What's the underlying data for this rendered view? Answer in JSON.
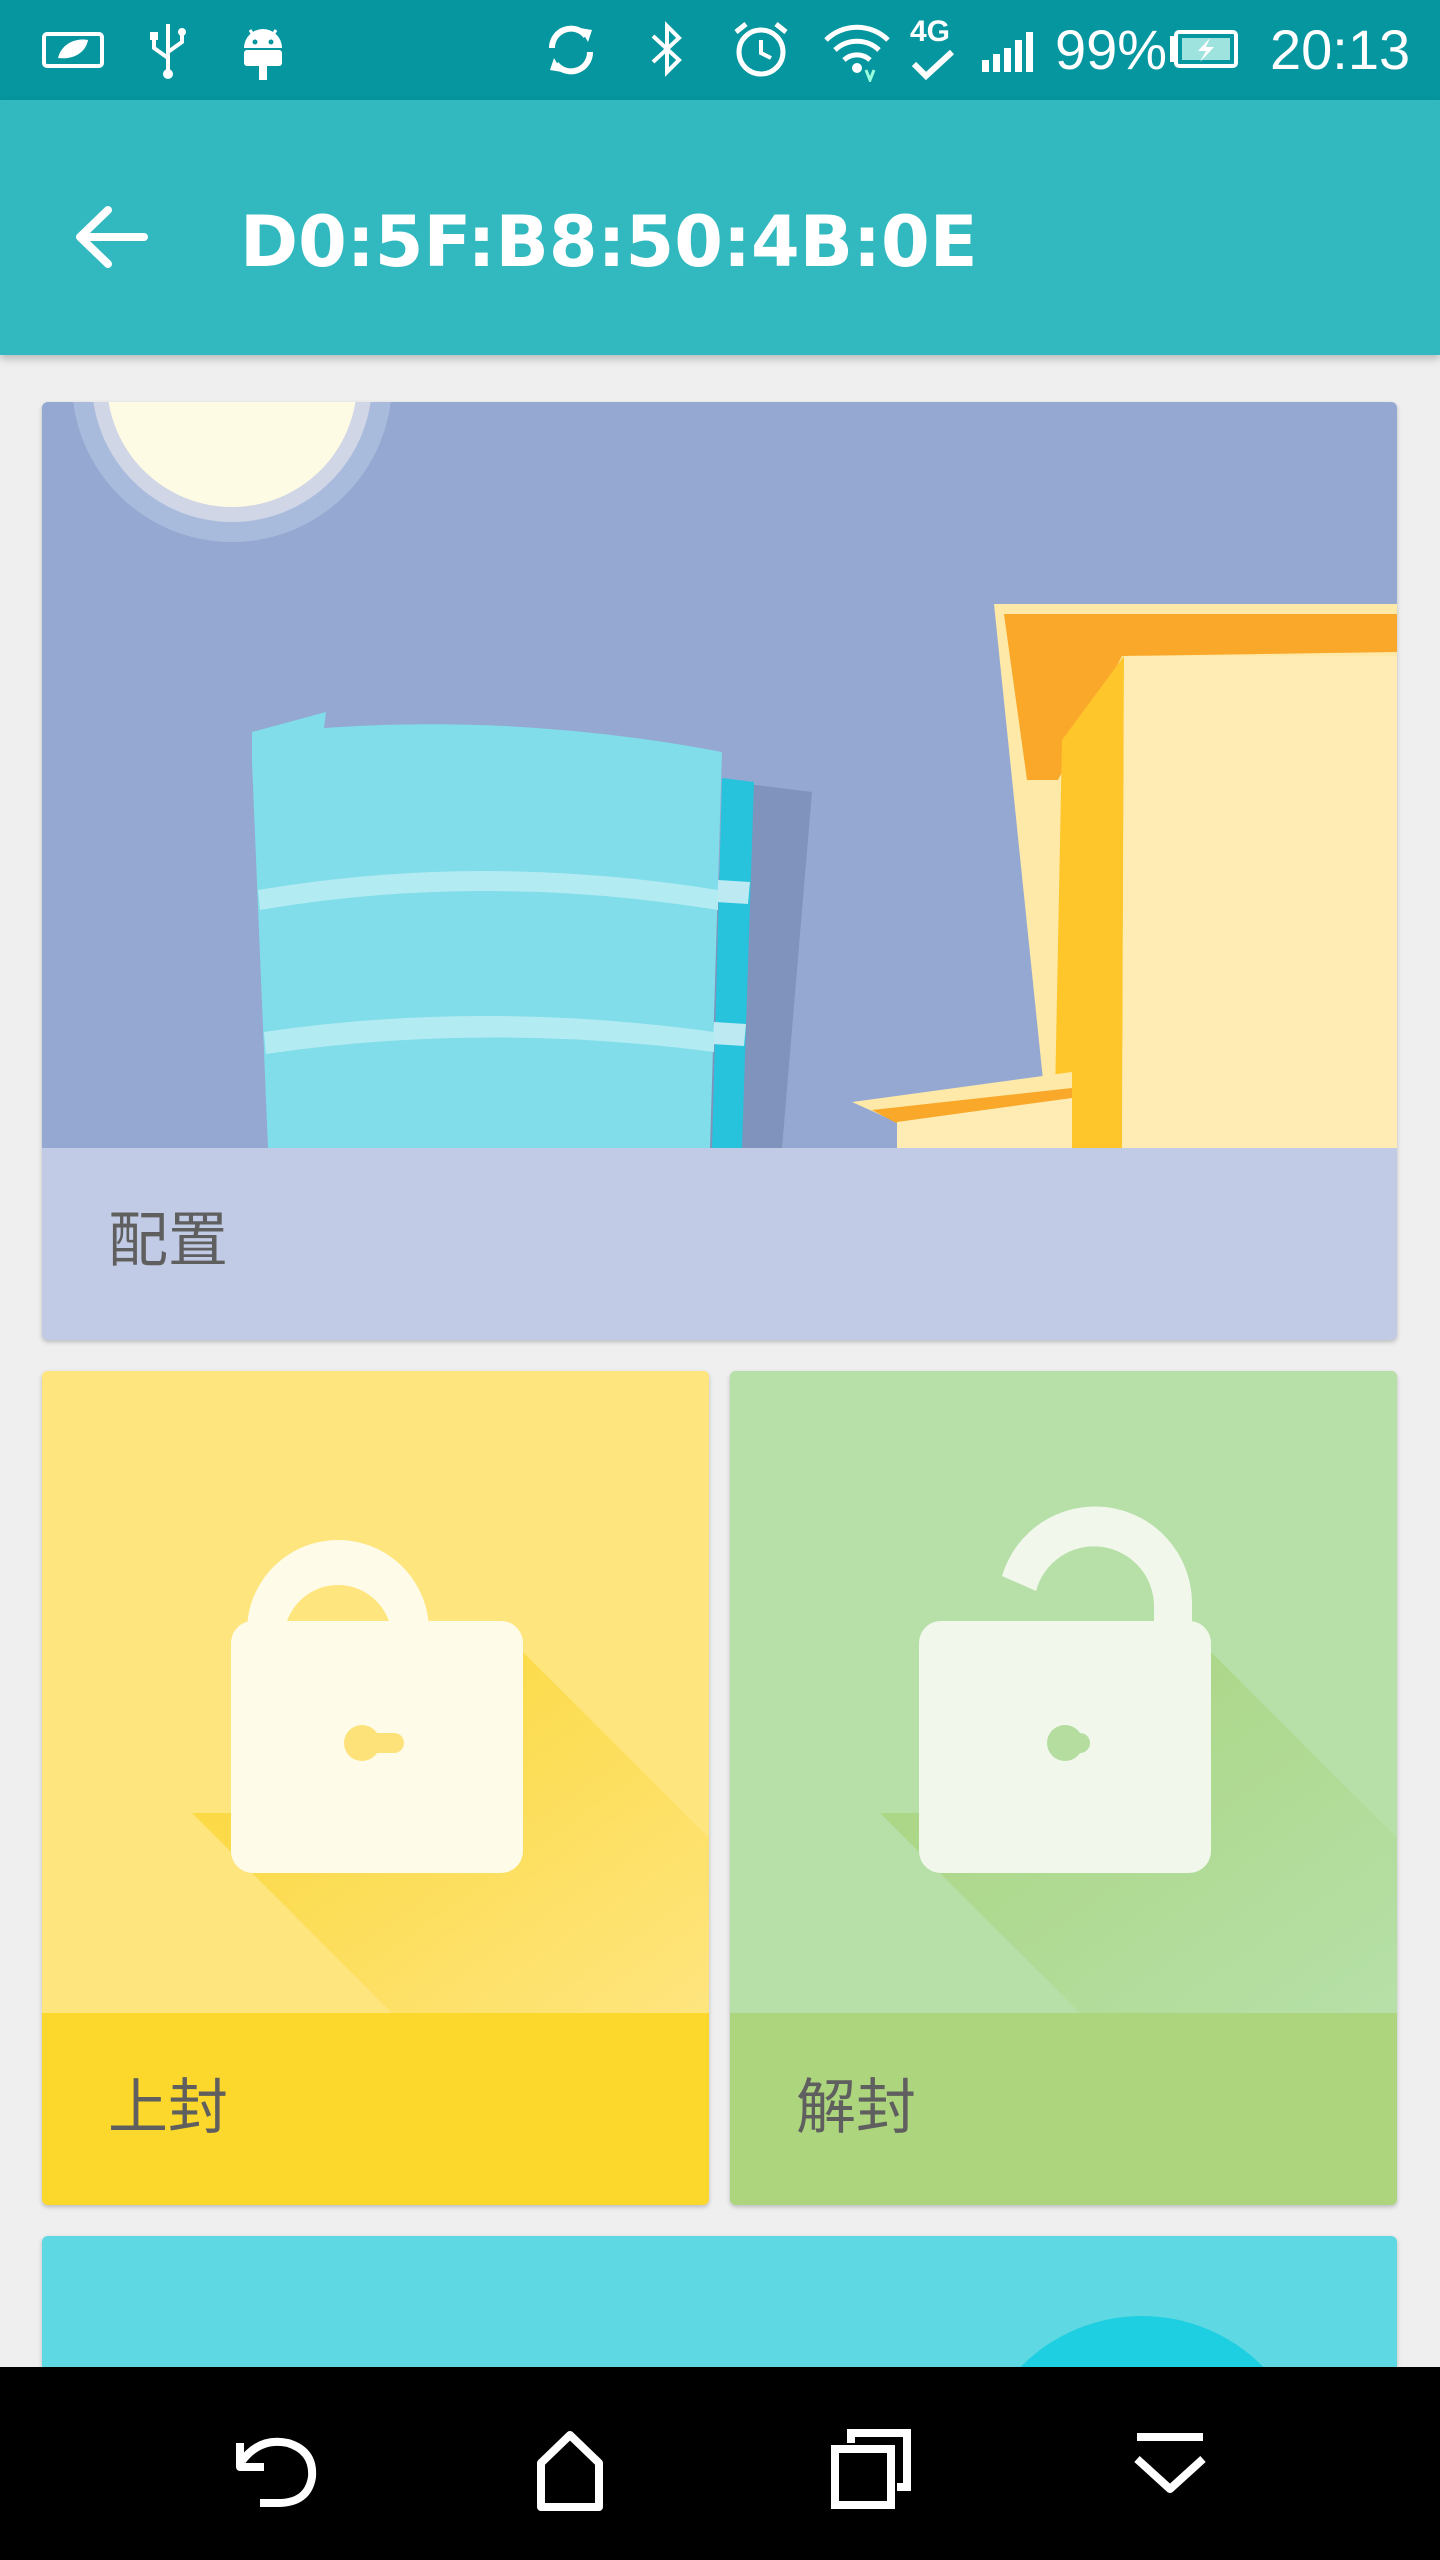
{
  "status_bar": {
    "battery_percent": "99%",
    "time": "20:13",
    "network": "4G",
    "icons": [
      "power-saver-icon",
      "usb-icon",
      "android-debug-icon",
      "sync-icon",
      "bluetooth-icon",
      "alarm-icon",
      "wifi-icon",
      "mobile-data-icon",
      "signal-icon",
      "battery-charging-icon"
    ]
  },
  "app_bar": {
    "title": "D0:5F:B8:50:4B:0E",
    "back_icon": "arrow-left-icon"
  },
  "cards": {
    "config": {
      "label": "配置",
      "color": "#c2cbe5",
      "image_bg": "#94a8d1"
    },
    "lock": {
      "label": "上封",
      "color": "#fcd82c",
      "image_bg": "#fee57e",
      "icon": "lock-closed-icon"
    },
    "unlock": {
      "label": "解封",
      "color": "#acd57d",
      "image_bg": "#b6e0a8",
      "icon": "lock-open-icon"
    },
    "partial": {
      "color": "#5ed8e3"
    }
  },
  "nav_bar": {
    "icons": [
      "back-icon",
      "home-icon",
      "recents-icon",
      "hide-nav-icon"
    ]
  },
  "colors": {
    "status_bar": "#06969f",
    "app_bar": "#32b9c0",
    "background": "#efefef"
  }
}
